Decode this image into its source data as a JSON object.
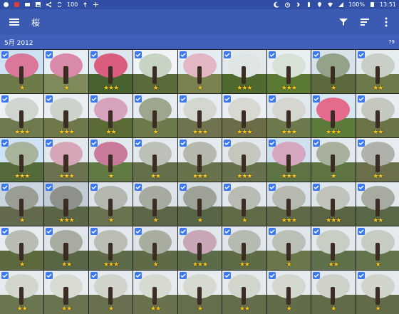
{
  "status": {
    "battery": "100%",
    "time": "13:51",
    "left_number": "100"
  },
  "appbar": {
    "title": "桜"
  },
  "section": {
    "label": "5月 2012",
    "count": "79"
  },
  "grid": {
    "columns": 9,
    "rows": 6,
    "tiles": [
      {
        "stars": "★",
        "sky": "#cde2f2",
        "crown": "#d9789a",
        "ground": "#6d7b4b"
      },
      {
        "stars": "★",
        "sky": "#e6eef6",
        "crown": "#d98aa8",
        "ground": "#7e8a59"
      },
      {
        "stars": "★★★",
        "sky": "#dbe6ef",
        "crown": "#d95d7f",
        "ground": "#47622e"
      },
      {
        "stars": "★",
        "sky": "#f0f4f6",
        "crown": "#c7d3c3",
        "ground": "#5b6a3a"
      },
      {
        "stars": "★",
        "sky": "#e3eef4",
        "crown": "#e2b6c3",
        "ground": "#7a8250"
      },
      {
        "stars": "★★★",
        "sky": "#e2e9ed",
        "crown": "#dfe5e3",
        "ground": "#4f6a2e"
      },
      {
        "stars": "★★★",
        "sky": "#e8f0f3",
        "crown": "#d8e2d6",
        "ground": "#5a7a33"
      },
      {
        "stars": "★",
        "sky": "#d7e3eb",
        "crown": "#95a28a",
        "ground": "#5d6a3d"
      },
      {
        "stars": "★★",
        "sky": "#e6edf1",
        "crown": "#c9cec7",
        "ground": "#6d7a4a"
      },
      {
        "stars": "★★★",
        "sky": "#edf2f5",
        "crown": "#d0d5cf",
        "ground": "#6f7a4e"
      },
      {
        "stars": "★★★",
        "sky": "#e8eef2",
        "crown": "#ccd3cc",
        "ground": "#6f784a"
      },
      {
        "stars": "★★",
        "sky": "#e5eaf0",
        "crown": "#d7a2bd",
        "ground": "#5a6b35"
      },
      {
        "stars": "★",
        "sky": "#e6edf2",
        "crown": "#9fa690",
        "ground": "#6d7b4c"
      },
      {
        "stars": "★★★",
        "sky": "#e7eef3",
        "crown": "#d4d6d0",
        "ground": "#70734f"
      },
      {
        "stars": "★★★",
        "sky": "#e9f0f4",
        "crown": "#d7d8d2",
        "ground": "#6a6d48"
      },
      {
        "stars": "★★★",
        "sky": "#e1e8ee",
        "crown": "#d4d6cf",
        "ground": "#6c7a4d"
      },
      {
        "stars": "★★★",
        "sky": "#d7e7f2",
        "crown": "#e46b8c",
        "ground": "#5c7b3b"
      },
      {
        "stars": "★★",
        "sky": "#e8edf1",
        "crown": "#c4c8be",
        "ground": "#6a7447"
      },
      {
        "stars": "★★★",
        "sky": "#cfe3f6",
        "crown": "#a8b39c",
        "ground": "#556a3a"
      },
      {
        "stars": "★★★",
        "sky": "#e2e9ee",
        "crown": "#d6a5b8",
        "ground": "#6b7250"
      },
      {
        "stars": "★",
        "sky": "#e3eaef",
        "crown": "#c97a9b",
        "ground": "#617a43"
      },
      {
        "stars": "★★",
        "sky": "#e4eaee",
        "crown": "#bcc0b6",
        "ground": "#64704c"
      },
      {
        "stars": "★★★",
        "sky": "#e5ebef",
        "crown": "#b5b8ad",
        "ground": "#68724b"
      },
      {
        "stars": "★★★",
        "sky": "#e3e8ec",
        "crown": "#c5c7bf",
        "ground": "#66704c"
      },
      {
        "stars": "★★★",
        "sky": "#cfe0ef",
        "crown": "#d6a5bf",
        "ground": "#5f7445"
      },
      {
        "stars": "★",
        "sky": "#e2eaf0",
        "crown": "#a7b09b",
        "ground": "#5e7543"
      },
      {
        "stars": "★★",
        "sky": "#e6ecef",
        "crown": "#b0b1aa",
        "ground": "#6b704b"
      },
      {
        "stars": "★",
        "sky": "#c9d6e1",
        "crown": "#9a9d93",
        "ground": "#646a4d"
      },
      {
        "stars": "★★★",
        "sky": "#c2ccd6",
        "crown": "#8d9189",
        "ground": "#5b6648"
      },
      {
        "stars": "★",
        "sky": "#dde4ea",
        "crown": "#b3b7ae",
        "ground": "#6a7350"
      },
      {
        "stars": "★",
        "sky": "#dce3e9",
        "crown": "#a6aa9f",
        "ground": "#5d6648"
      },
      {
        "stars": "★",
        "sky": "#d7dfe6",
        "crown": "#9ea296",
        "ground": "#586546"
      },
      {
        "stars": "★",
        "sky": "#e3e9ee",
        "crown": "#b9bcb3",
        "ground": "#616b47"
      },
      {
        "stars": "★★★",
        "sky": "#dbe3ea",
        "crown": "#b6b9b0",
        "ground": "#606a48"
      },
      {
        "stars": "★★★",
        "sky": "#dfe6ec",
        "crown": "#c0c3ba",
        "ground": "#5a6546"
      },
      {
        "stars": "★★",
        "sky": "#e1e8ee",
        "crown": "#a8ab9f",
        "ground": "#596846"
      },
      {
        "stars": "★",
        "sky": "#e6ecf0",
        "crown": "#b8bcb2",
        "ground": "#5d6a3d"
      },
      {
        "stars": "★★",
        "sky": "#dfe6ec",
        "crown": "#a8ab9f",
        "ground": "#576745"
      },
      {
        "stars": "★★★",
        "sky": "#e3e9ee",
        "crown": "#babdb3",
        "ground": "#5e6b48"
      },
      {
        "stars": "★",
        "sky": "#dfe5ea",
        "crown": "#a9ad9f",
        "ground": "#5f6a46"
      },
      {
        "stars": "★★★",
        "sky": "#e2e8ec",
        "crown": "#c7a6b8",
        "ground": "#5b6c4a"
      },
      {
        "stars": "★★",
        "sky": "#e1e7ec",
        "crown": "#b6bbb1",
        "ground": "#5d6c47"
      },
      {
        "stars": "★",
        "sky": "#dfe6ec",
        "crown": "#bac0b6",
        "ground": "#6b774a"
      },
      {
        "stars": "★★",
        "sky": "#e4e9ee",
        "crown": "#c9cec4",
        "ground": "#5f714a"
      },
      {
        "stars": "★",
        "sky": "#e5eaef",
        "crown": "#c7ccc2",
        "ground": "#63744c"
      },
      {
        "stars": "★★",
        "sky": "#e6ebef",
        "crown": "#d3d6cd",
        "ground": "#6a7650"
      },
      {
        "stars": "★★",
        "sky": "#e7ecf0",
        "crown": "#d8dbd1",
        "ground": "#6a7350"
      },
      {
        "stars": "★",
        "sky": "#e5eaef",
        "crown": "#d1d4cb",
        "ground": "#68704f"
      },
      {
        "stars": "★★",
        "sky": "#e6ebef",
        "crown": "#d7dad0",
        "ground": "#69714f"
      },
      {
        "stars": "★",
        "sky": "#e7ecf0",
        "crown": "#d6d9cf",
        "ground": "#656f4d"
      },
      {
        "stars": "★★",
        "sky": "#e5eaef",
        "crown": "#d2d5cc",
        "ground": "#646d4b"
      },
      {
        "stars": "★",
        "sky": "#e6ebef",
        "crown": "#d4d7cd",
        "ground": "#636c4a"
      },
      {
        "stars": "★",
        "sky": "#e4e9ee",
        "crown": "#cfd2c9",
        "ground": "#626b49"
      },
      {
        "stars": "★",
        "sky": "#e5eaef",
        "crown": "#d1d4cb",
        "ground": "#616a49"
      }
    ]
  }
}
